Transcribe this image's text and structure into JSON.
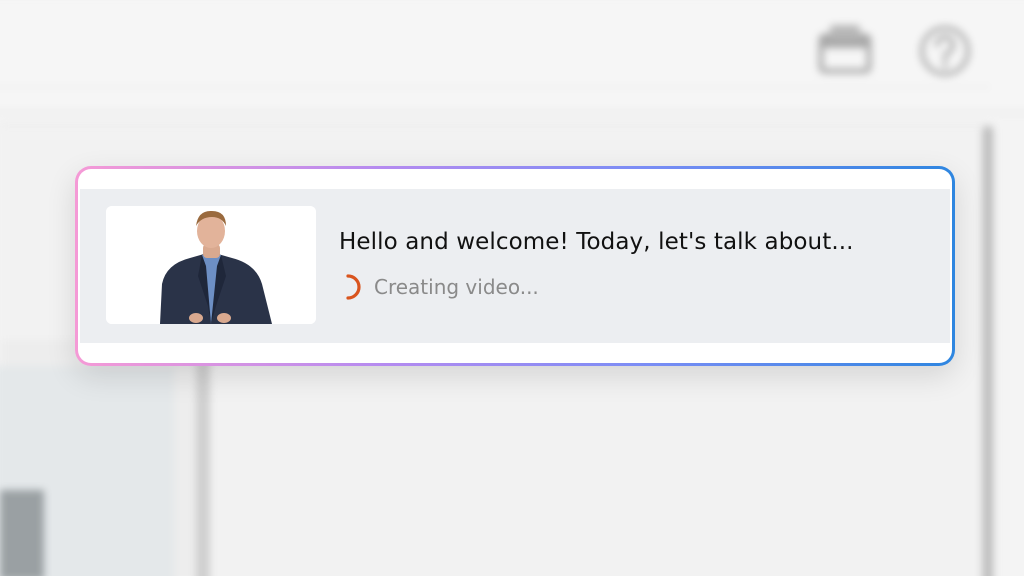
{
  "card": {
    "headline": "Hello and welcome! Today, let's talk about...",
    "status_text": "Creating video..."
  },
  "icons": {
    "gift": "gift-icon",
    "help": "help-circle-icon",
    "spinner": "loading-spinner-icon"
  },
  "colors": {
    "spinner": "#d9541e",
    "gradient_start": "#f59ad6",
    "gradient_end": "#2e86e0"
  }
}
